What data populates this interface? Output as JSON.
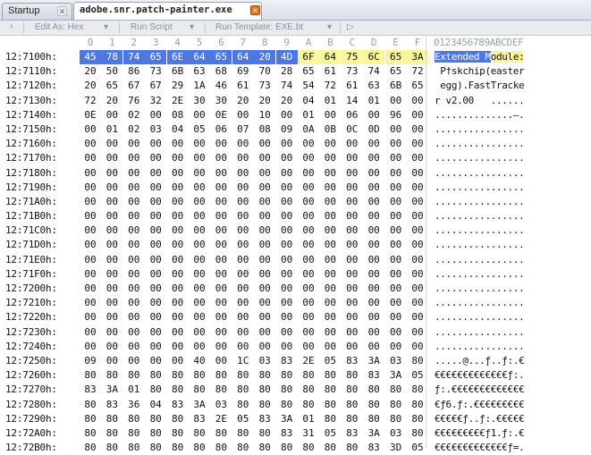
{
  "tabs": [
    {
      "label": "Startup",
      "active": false
    },
    {
      "label": "adobe.snr.patch-painter.exe",
      "active": true
    }
  ],
  "toolbar": {
    "menu_icon": "chevron-down-icon",
    "edit_as": "Edit As: Hex",
    "run_script": "Run Script",
    "run_template": "Run Template: EXE.bt",
    "play_icon": "play-icon"
  },
  "columns": [
    "0",
    "1",
    "2",
    "3",
    "4",
    "5",
    "6",
    "7",
    "8",
    "9",
    "A",
    "B",
    "C",
    "D",
    "E",
    "F"
  ],
  "ascii_header": "0123456789ABCDEF",
  "colors": {
    "selection": "#4d78e4",
    "highlight": "#fbf59c"
  },
  "rows": [
    {
      "addr": "12:7100h:",
      "bytes": [
        "45",
        "78",
        "74",
        "65",
        "6E",
        "64",
        "65",
        "64",
        "20",
        "4D",
        "6F",
        "64",
        "75",
        "6C",
        "65",
        "3A"
      ],
      "ascii": "Extended Module:",
      "sel": [
        0,
        10
      ],
      "yel": [
        10,
        16
      ]
    },
    {
      "addr": "12:7110h:",
      "bytes": [
        "20",
        "50",
        "86",
        "73",
        "6B",
        "63",
        "68",
        "69",
        "70",
        "28",
        "65",
        "61",
        "73",
        "74",
        "65",
        "72"
      ],
      "ascii": " P†skchip(easter"
    },
    {
      "addr": "12:7120h:",
      "bytes": [
        "20",
        "65",
        "67",
        "67",
        "29",
        "1A",
        "46",
        "61",
        "73",
        "74",
        "54",
        "72",
        "61",
        "63",
        "6B",
        "65"
      ],
      "ascii": " egg).FastTracke"
    },
    {
      "addr": "12:7130h:",
      "bytes": [
        "72",
        "20",
        "76",
        "32",
        "2E",
        "30",
        "30",
        "20",
        "20",
        "20",
        "04",
        "01",
        "14",
        "01",
        "00",
        "00"
      ],
      "ascii": "r v2.00   ......"
    },
    {
      "addr": "12:7140h:",
      "bytes": [
        "0E",
        "00",
        "02",
        "00",
        "08",
        "00",
        "0E",
        "00",
        "10",
        "00",
        "01",
        "00",
        "06",
        "00",
        "96",
        "00"
      ],
      "ascii": "..............–."
    },
    {
      "addr": "12:7150h:",
      "bytes": [
        "00",
        "01",
        "02",
        "03",
        "04",
        "05",
        "06",
        "07",
        "08",
        "09",
        "0A",
        "0B",
        "0C",
        "0D",
        "00",
        "00"
      ],
      "ascii": "................"
    },
    {
      "addr": "12:7160h:",
      "bytes": [
        "00",
        "00",
        "00",
        "00",
        "00",
        "00",
        "00",
        "00",
        "00",
        "00",
        "00",
        "00",
        "00",
        "00",
        "00",
        "00"
      ],
      "ascii": "................"
    },
    {
      "addr": "12:7170h:",
      "bytes": [
        "00",
        "00",
        "00",
        "00",
        "00",
        "00",
        "00",
        "00",
        "00",
        "00",
        "00",
        "00",
        "00",
        "00",
        "00",
        "00"
      ],
      "ascii": "................"
    },
    {
      "addr": "12:7180h:",
      "bytes": [
        "00",
        "00",
        "00",
        "00",
        "00",
        "00",
        "00",
        "00",
        "00",
        "00",
        "00",
        "00",
        "00",
        "00",
        "00",
        "00"
      ],
      "ascii": "................"
    },
    {
      "addr": "12:7190h:",
      "bytes": [
        "00",
        "00",
        "00",
        "00",
        "00",
        "00",
        "00",
        "00",
        "00",
        "00",
        "00",
        "00",
        "00",
        "00",
        "00",
        "00"
      ],
      "ascii": "................"
    },
    {
      "addr": "12:71A0h:",
      "bytes": [
        "00",
        "00",
        "00",
        "00",
        "00",
        "00",
        "00",
        "00",
        "00",
        "00",
        "00",
        "00",
        "00",
        "00",
        "00",
        "00"
      ],
      "ascii": "................"
    },
    {
      "addr": "12:71B0h:",
      "bytes": [
        "00",
        "00",
        "00",
        "00",
        "00",
        "00",
        "00",
        "00",
        "00",
        "00",
        "00",
        "00",
        "00",
        "00",
        "00",
        "00"
      ],
      "ascii": "................"
    },
    {
      "addr": "12:71C0h:",
      "bytes": [
        "00",
        "00",
        "00",
        "00",
        "00",
        "00",
        "00",
        "00",
        "00",
        "00",
        "00",
        "00",
        "00",
        "00",
        "00",
        "00"
      ],
      "ascii": "................"
    },
    {
      "addr": "12:71D0h:",
      "bytes": [
        "00",
        "00",
        "00",
        "00",
        "00",
        "00",
        "00",
        "00",
        "00",
        "00",
        "00",
        "00",
        "00",
        "00",
        "00",
        "00"
      ],
      "ascii": "................"
    },
    {
      "addr": "12:71E0h:",
      "bytes": [
        "00",
        "00",
        "00",
        "00",
        "00",
        "00",
        "00",
        "00",
        "00",
        "00",
        "00",
        "00",
        "00",
        "00",
        "00",
        "00"
      ],
      "ascii": "................"
    },
    {
      "addr": "12:71F0h:",
      "bytes": [
        "00",
        "00",
        "00",
        "00",
        "00",
        "00",
        "00",
        "00",
        "00",
        "00",
        "00",
        "00",
        "00",
        "00",
        "00",
        "00"
      ],
      "ascii": "................"
    },
    {
      "addr": "12:7200h:",
      "bytes": [
        "00",
        "00",
        "00",
        "00",
        "00",
        "00",
        "00",
        "00",
        "00",
        "00",
        "00",
        "00",
        "00",
        "00",
        "00",
        "00"
      ],
      "ascii": "................"
    },
    {
      "addr": "12:7210h:",
      "bytes": [
        "00",
        "00",
        "00",
        "00",
        "00",
        "00",
        "00",
        "00",
        "00",
        "00",
        "00",
        "00",
        "00",
        "00",
        "00",
        "00"
      ],
      "ascii": "................"
    },
    {
      "addr": "12:7220h:",
      "bytes": [
        "00",
        "00",
        "00",
        "00",
        "00",
        "00",
        "00",
        "00",
        "00",
        "00",
        "00",
        "00",
        "00",
        "00",
        "00",
        "00"
      ],
      "ascii": "................"
    },
    {
      "addr": "12:7230h:",
      "bytes": [
        "00",
        "00",
        "00",
        "00",
        "00",
        "00",
        "00",
        "00",
        "00",
        "00",
        "00",
        "00",
        "00",
        "00",
        "00",
        "00"
      ],
      "ascii": "................"
    },
    {
      "addr": "12:7240h:",
      "bytes": [
        "00",
        "00",
        "00",
        "00",
        "00",
        "00",
        "00",
        "00",
        "00",
        "00",
        "00",
        "00",
        "00",
        "00",
        "00",
        "00"
      ],
      "ascii": "................"
    },
    {
      "addr": "12:7250h:",
      "bytes": [
        "09",
        "00",
        "00",
        "00",
        "00",
        "40",
        "00",
        "1C",
        "03",
        "83",
        "2E",
        "05",
        "83",
        "3A",
        "03",
        "80"
      ],
      "ascii": ".....@...ƒ..ƒ:.€"
    },
    {
      "addr": "12:7260h:",
      "bytes": [
        "80",
        "80",
        "80",
        "80",
        "80",
        "80",
        "80",
        "80",
        "80",
        "80",
        "80",
        "80",
        "80",
        "83",
        "3A",
        "05"
      ],
      "ascii": "€€€€€€€€€€€€€ƒ:."
    },
    {
      "addr": "12:7270h:",
      "bytes": [
        "83",
        "3A",
        "01",
        "80",
        "80",
        "80",
        "80",
        "80",
        "80",
        "80",
        "80",
        "80",
        "80",
        "80",
        "80",
        "80"
      ],
      "ascii": "ƒ:.€€€€€€€€€€€€€"
    },
    {
      "addr": "12:7280h:",
      "bytes": [
        "80",
        "83",
        "36",
        "04",
        "83",
        "3A",
        "03",
        "80",
        "80",
        "80",
        "80",
        "80",
        "80",
        "80",
        "80",
        "80"
      ],
      "ascii": "€ƒ6.ƒ:.€€€€€€€€€"
    },
    {
      "addr": "12:7290h:",
      "bytes": [
        "80",
        "80",
        "80",
        "80",
        "80",
        "83",
        "2E",
        "05",
        "83",
        "3A",
        "01",
        "80",
        "80",
        "80",
        "80",
        "80"
      ],
      "ascii": "€€€€€ƒ..ƒ:.€€€€€"
    },
    {
      "addr": "12:72A0h:",
      "bytes": [
        "80",
        "80",
        "80",
        "80",
        "80",
        "80",
        "80",
        "80",
        "80",
        "83",
        "31",
        "05",
        "83",
        "3A",
        "03",
        "80"
      ],
      "ascii": "€€€€€€€€€ƒ1.ƒ:.€"
    },
    {
      "addr": "12:72B0h:",
      "bytes": [
        "80",
        "80",
        "80",
        "80",
        "80",
        "80",
        "80",
        "80",
        "80",
        "80",
        "80",
        "80",
        "80",
        "83",
        "3D",
        "05"
      ],
      "ascii": "€€€€€€€€€€€€€ƒ=."
    }
  ]
}
